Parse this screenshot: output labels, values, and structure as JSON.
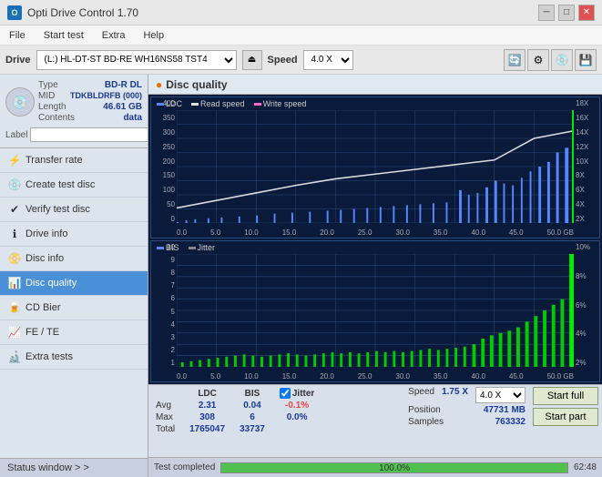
{
  "titlebar": {
    "title": "Opti Drive Control 1.70",
    "icon_label": "O"
  },
  "menubar": {
    "items": [
      "File",
      "Start test",
      "Extra",
      "Help"
    ]
  },
  "drivebar": {
    "label": "Drive",
    "drive_value": "(L:)  HL-DT-ST BD-RE  WH16NS58 TST4",
    "speed_label": "Speed",
    "speed_value": "4.0 X"
  },
  "disc": {
    "type_label": "Type",
    "type_value": "BD-R DL",
    "mid_label": "MID",
    "mid_value": "TDKBLDRFB (000)",
    "length_label": "Length",
    "length_value": "46.61 GB",
    "contents_label": "Contents",
    "contents_value": "data",
    "label_label": "Label",
    "label_value": ""
  },
  "nav": {
    "items": [
      {
        "id": "transfer-rate",
        "label": "Transfer rate",
        "icon": "⚡"
      },
      {
        "id": "create-test-disc",
        "label": "Create test disc",
        "icon": "💿"
      },
      {
        "id": "verify-test-disc",
        "label": "Verify test disc",
        "icon": "✔"
      },
      {
        "id": "drive-info",
        "label": "Drive info",
        "icon": "ℹ"
      },
      {
        "id": "disc-info",
        "label": "Disc info",
        "icon": "📀"
      },
      {
        "id": "disc-quality",
        "label": "Disc quality",
        "icon": "📊",
        "active": true
      },
      {
        "id": "cd-bier",
        "label": "CD Bier",
        "icon": "🍺"
      },
      {
        "id": "fe-te",
        "label": "FE / TE",
        "icon": "📈"
      },
      {
        "id": "extra-tests",
        "label": "Extra tests",
        "icon": "🔬"
      }
    ]
  },
  "status_window": {
    "label": "Status window > >"
  },
  "disc_quality": {
    "title": "Disc quality",
    "chart_top": {
      "legend": [
        {
          "id": "ldc",
          "label": "LDC",
          "color": "#5588ff"
        },
        {
          "id": "read",
          "label": "Read speed",
          "color": "#dddddd"
        },
        {
          "id": "write",
          "label": "Write speed",
          "color": "#ff66cc"
        }
      ],
      "y_left": [
        "400",
        "350",
        "300",
        "250",
        "200",
        "150",
        "100",
        "50",
        "0"
      ],
      "y_right": [
        "18X",
        "16X",
        "14X",
        "12X",
        "10X",
        "8X",
        "6X",
        "4X",
        "2X"
      ],
      "x_labels": [
        "0.0",
        "5.0",
        "10.0",
        "15.0",
        "20.0",
        "25.0",
        "30.0",
        "35.0",
        "40.0",
        "45.0",
        "50.0 GB"
      ]
    },
    "chart_bottom": {
      "legend": [
        {
          "id": "bis",
          "label": "BIS",
          "color": "#5588ff"
        },
        {
          "id": "jitter",
          "label": "Jitter",
          "color": "#aaaaaa"
        }
      ],
      "y_left": [
        "10",
        "9",
        "8",
        "7",
        "6",
        "5",
        "4",
        "3",
        "2",
        "1"
      ],
      "y_right": [
        "10%",
        "8%",
        "6%",
        "4%",
        "2%"
      ],
      "x_labels": [
        "0.0",
        "5.0",
        "10.0",
        "15.0",
        "20.0",
        "25.0",
        "30.0",
        "35.0",
        "40.0",
        "45.0",
        "50.0 GB"
      ]
    }
  },
  "stats": {
    "col_ldc": "LDC",
    "col_bis": "BIS",
    "col_jitter_label": "✓ Jitter",
    "row_avg": {
      "label": "Avg",
      "ldc": "2.31",
      "bis": "0.04",
      "jitter": "-0.1%"
    },
    "row_max": {
      "label": "Max",
      "ldc": "308",
      "bis": "6",
      "jitter": "0.0%"
    },
    "row_total": {
      "label": "Total",
      "ldc": "1765047",
      "bis": "33737",
      "jitter": ""
    },
    "speed_label": "Speed",
    "speed_value": "1.75 X",
    "speed_select": "4.0 X",
    "position_label": "Position",
    "position_value": "47731 MB",
    "samples_label": "Samples",
    "samples_value": "763332",
    "start_full": "Start full",
    "start_part": "Start part"
  },
  "progress": {
    "label": "Test completed",
    "percent": "100.0%",
    "fill": 100,
    "time": "62:48"
  }
}
